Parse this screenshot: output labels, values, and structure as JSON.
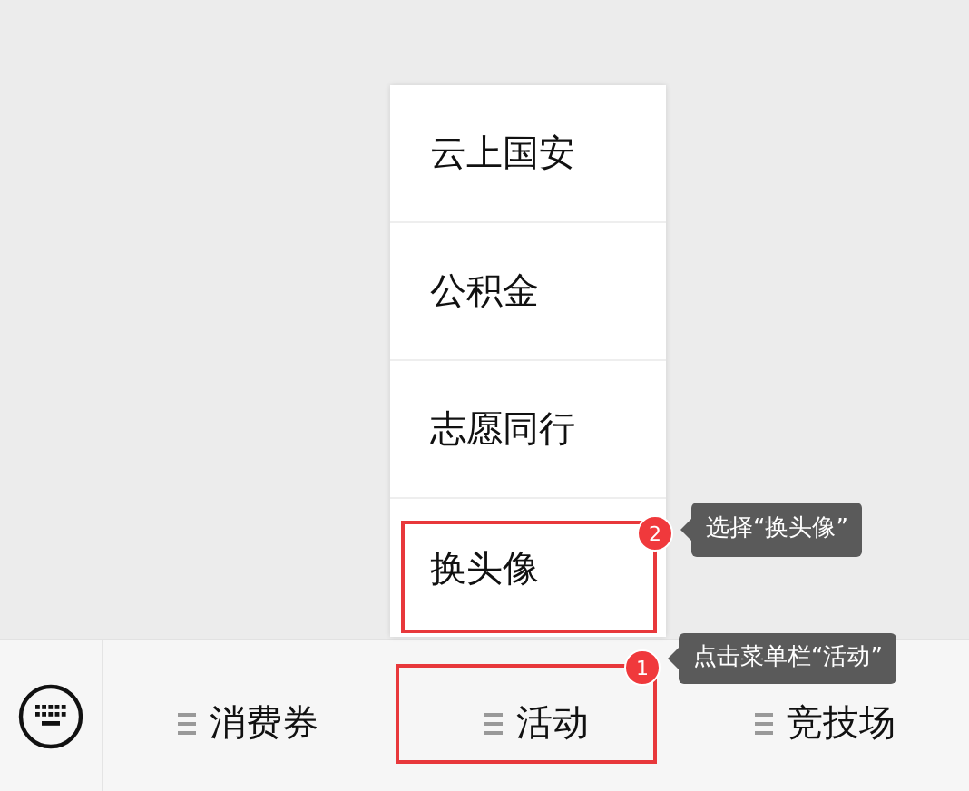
{
  "popup_menu": {
    "items": [
      {
        "label": "云上国安",
        "highlighted": false
      },
      {
        "label": "公积金",
        "highlighted": false
      },
      {
        "label": "志愿同行",
        "highlighted": false
      },
      {
        "label": "换头像",
        "highlighted": true,
        "callout": {
          "badge": "2",
          "text": "选择“换头像”"
        }
      }
    ]
  },
  "menu_bar": {
    "items": [
      {
        "label": "消费券",
        "highlighted": false
      },
      {
        "label": "活动",
        "highlighted": true,
        "callout": {
          "badge": "1",
          "text": "点击菜单栏“活动”"
        }
      },
      {
        "label": "竞技场",
        "highlighted": false
      }
    ]
  }
}
